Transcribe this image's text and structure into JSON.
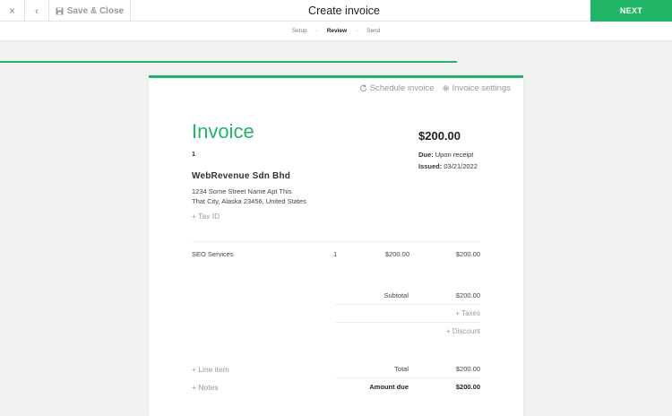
{
  "topbar": {
    "close_glyph": "×",
    "back_glyph": "‹",
    "save_label": "Save & Close",
    "title": "Create invoice",
    "next_label": "NEXT"
  },
  "steps": {
    "setup": "Setup",
    "review": "Review",
    "send": "Send",
    "active": "Review",
    "progress_fraction": 0.68
  },
  "actions": {
    "schedule_label": "Schedule invoice",
    "settings_label": "Invoice settings"
  },
  "invoice": {
    "title": "Invoice",
    "number": "1",
    "total": "$200.00",
    "due_label": "Due:",
    "due_value": "Upon receipt",
    "issued_label": "Issued:",
    "issued_value": "03/21/2022",
    "company": "WebRevenue Sdn Bhd",
    "address_line1": "1234 Some Street Name Apt This",
    "address_line2": "That City, Alaska 23456, United States",
    "tax_id_link": "+ Tax ID"
  },
  "line_items": [
    {
      "description": "SEO Services",
      "qty": "1",
      "rate": "$200.00",
      "amount": "$200.00"
    }
  ],
  "summary": {
    "subtotal_label": "Subtotal",
    "subtotal_value": "$200.00",
    "taxes_link": "+ Taxes",
    "discount_link": "+ Discount",
    "total_label": "Total",
    "total_value": "$200.00",
    "amount_due_label": "Amount due",
    "amount_due_value": "$200.00"
  },
  "links": {
    "line_item": "+ Line item",
    "notes": "+ Notes"
  },
  "colors": {
    "accent": "#20b566",
    "background": "#f1f1f1"
  }
}
